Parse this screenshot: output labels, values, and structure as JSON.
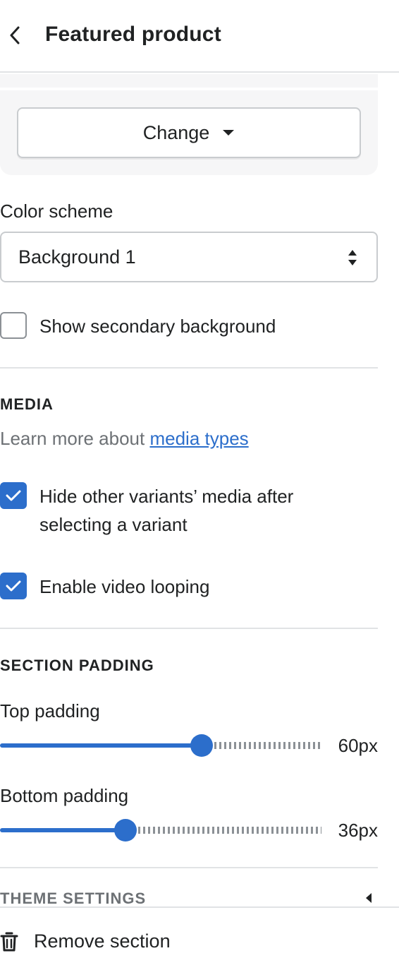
{
  "header": {
    "title": "Featured product"
  },
  "product_picker": {
    "change_label": "Change"
  },
  "color_scheme": {
    "label": "Color scheme",
    "value": "Background 1"
  },
  "secondary_background": {
    "label": "Show secondary background",
    "checked": false
  },
  "media": {
    "heading": "MEDIA",
    "helper_prefix": "Learn more about ",
    "helper_link": "media types",
    "hide_variants_line1": "Hide other variants’ media after",
    "hide_variants_line2": "selecting a variant",
    "hide_variants_checked": true,
    "video_looping_label": "Enable video looping",
    "video_looping_checked": true
  },
  "section_padding": {
    "heading": "SECTION PADDING",
    "top": {
      "label": "Top padding",
      "value_text": "60px",
      "fraction": 0.6
    },
    "bottom": {
      "label": "Bottom padding",
      "value_text": "36px",
      "fraction": 0.36
    }
  },
  "theme_settings": {
    "label": "THEME SETTINGS"
  },
  "footer": {
    "remove_label": "Remove section"
  },
  "colors": {
    "accent": "#2c6ecb",
    "border": "#c9cccf",
    "muted_text": "#6d7175",
    "card_bg": "#f6f6f7"
  },
  "icons": [
    "chevron-left-icon",
    "caret-down-icon",
    "select-arrows-icon",
    "checkmark-icon",
    "caret-left-icon",
    "trash-icon"
  ]
}
